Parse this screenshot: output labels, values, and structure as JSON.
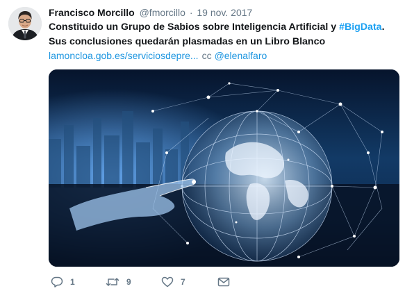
{
  "tweet": {
    "author": {
      "display_name": "Francisco Morcillo",
      "handle": "@fmorcillo"
    },
    "separator": "·",
    "date": "19 nov. 2017",
    "text_before": "Constituido un Grupo de Sabios sobre Inteligencia Artificial y ",
    "hashtag": "#BigData",
    "text_after": ". Sus conclusiones quedarán plasmadas en un Libro Blanco",
    "link": "lamoncloa.gob.es/serviciosdepre...",
    "cc_label": "cc",
    "mention": "@elenalfaro",
    "actions": {
      "reply_count": "1",
      "retweet_count": "9",
      "like_count": "7"
    }
  },
  "colors": {
    "link": "#1b95e0",
    "hashtag": "#1da1f2",
    "muted": "#657786",
    "text": "#14171a"
  },
  "icons": {
    "reply": "reply-bubble-icon",
    "retweet": "retweet-arrows-icon",
    "like": "heart-outline-icon",
    "message": "envelope-icon"
  }
}
